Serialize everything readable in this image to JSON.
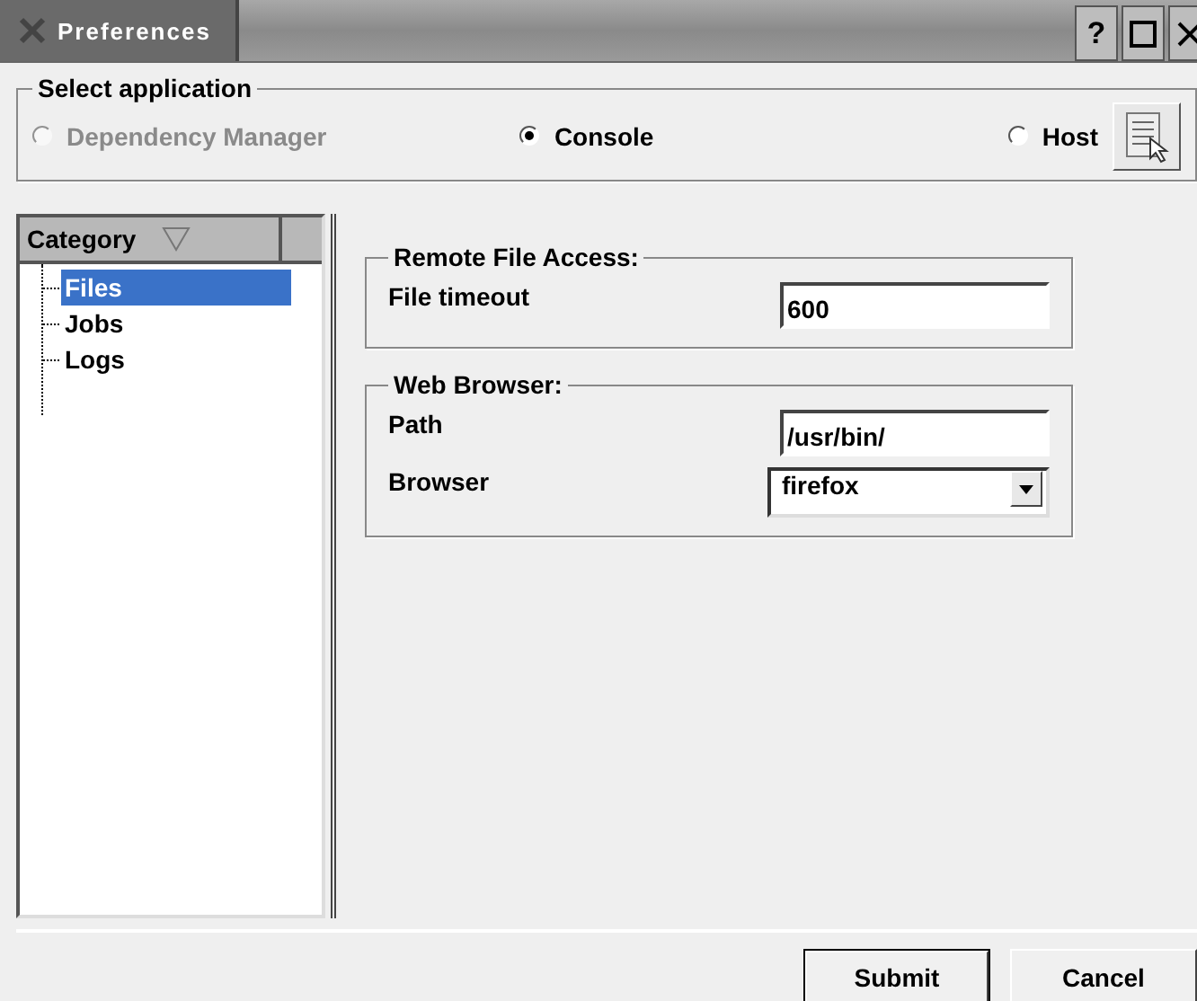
{
  "window": {
    "title": "Preferences",
    "buttons": [
      "?"
    ]
  },
  "select_application": {
    "title": "Select application",
    "options": [
      {
        "label": "Dependency Manager",
        "selected": false,
        "disabled": true
      },
      {
        "label": "Console",
        "selected": true,
        "disabled": false
      },
      {
        "label": "Host",
        "selected": false,
        "disabled": false
      }
    ]
  },
  "category": {
    "header": "Category",
    "items": [
      {
        "label": "Files",
        "selected": true
      },
      {
        "label": "Jobs",
        "selected": false
      },
      {
        "label": "Logs",
        "selected": false
      }
    ]
  },
  "groups": [
    {
      "title": "Remote File Access:",
      "fields": [
        {
          "kind": "text",
          "label": "File timeout",
          "value": "600"
        }
      ]
    },
    {
      "title": "Web Browser:",
      "fields": [
        {
          "kind": "text",
          "label": "Path",
          "value": "/usr/bin/"
        },
        {
          "kind": "dropdown",
          "label": "Browser",
          "value": "firefox"
        }
      ]
    }
  ],
  "buttons": [
    {
      "label": "Submit",
      "default": true
    },
    {
      "label": "Cancel",
      "default": false
    }
  ]
}
